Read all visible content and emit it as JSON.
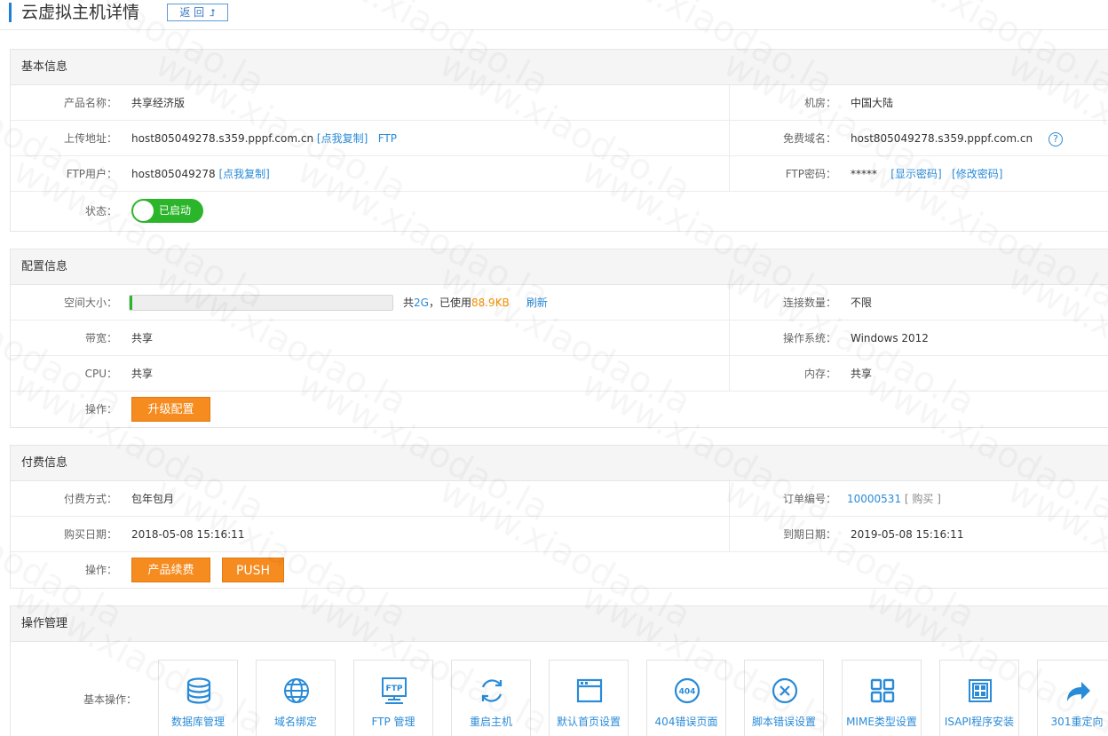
{
  "header": {
    "title": "云虚拟主机详情",
    "back_label": "返 回"
  },
  "basic": {
    "section_title": "基本信息",
    "product_label": "产品名称：",
    "product_value": "共享经济版",
    "room_label": "机房：",
    "room_value": "中国大陆",
    "upload_label": "上传地址：",
    "upload_value": "host805049278.s359.pppf.com.cn",
    "copy_link": "[点我复制]",
    "ftp_link": "FTP",
    "domain_label": "免费域名：",
    "domain_value": "host805049278.s359.pppf.com.cn",
    "help_icon": "?",
    "ftp_user_label": "FTP用户：",
    "ftp_user_value": "host805049278",
    "ftp_user_copy": "[点我复制]",
    "ftp_pwd_label": "FTP密码：",
    "ftp_pwd_value": "*****",
    "show_pwd": "[显示密码]",
    "change_pwd": "[修改密码]",
    "status_label": "状态：",
    "status_value": "已启动"
  },
  "config": {
    "section_title": "配置信息",
    "space_label": "空间大小：",
    "space_total_prefix": "共",
    "space_total": "2G",
    "space_used_prefix": "，已使用",
    "space_used": "88.9KB",
    "refresh": "刷新",
    "space_used_fraction": 0.01,
    "conn_label": "连接数量：",
    "conn_value": "不限",
    "bandwidth_label": "带宽：",
    "bandwidth_value": "共享",
    "os_label": "操作系统：",
    "os_value": "Windows 2012",
    "cpu_label": "CPU：",
    "cpu_value": "共享",
    "mem_label": "内存：",
    "mem_value": "共享",
    "op_label": "操作：",
    "upgrade_btn": "升级配置"
  },
  "billing": {
    "section_title": "付费信息",
    "pay_label": "付费方式：",
    "pay_value": "包年包月",
    "order_label": "订单编号：",
    "order_value": "10000531",
    "order_buy": "[ 购买 ]",
    "buy_date_label": "购买日期：",
    "buy_date_value": "2018-05-08 15:16:11",
    "expire_label": "到期日期：",
    "expire_value": "2019-05-08 15:16:11",
    "op_label": "操作：",
    "renew_btn": "产品续费",
    "push_btn": "PUSH"
  },
  "ops": {
    "section_title": "操作管理",
    "basic_label": "基本操作：",
    "tiles": [
      {
        "label": "数据库管理",
        "icon": "database-icon"
      },
      {
        "label": "域名绑定",
        "icon": "globe-icon"
      },
      {
        "label": "FTP 管理",
        "icon": "ftp-icon"
      },
      {
        "label": "重启主机",
        "icon": "restart-icon"
      },
      {
        "label": "默认首页设置",
        "icon": "browser-window-icon"
      },
      {
        "label": "404错误页面",
        "icon": "error-404-icon"
      },
      {
        "label": "脚本错误设置",
        "icon": "close-circle-icon"
      },
      {
        "label": "MIME类型设置",
        "icon": "grid-icon"
      },
      {
        "label": "ISAPI程序安装",
        "icon": "app-install-icon"
      },
      {
        "label": "301重定向",
        "icon": "redirect-icon"
      }
    ],
    "ftp_glyph": "FTP",
    "e404_glyph": "404"
  },
  "colors": {
    "accent": "#2a8bd8",
    "orange": "#f68b1f",
    "green": "#2bb52b"
  }
}
